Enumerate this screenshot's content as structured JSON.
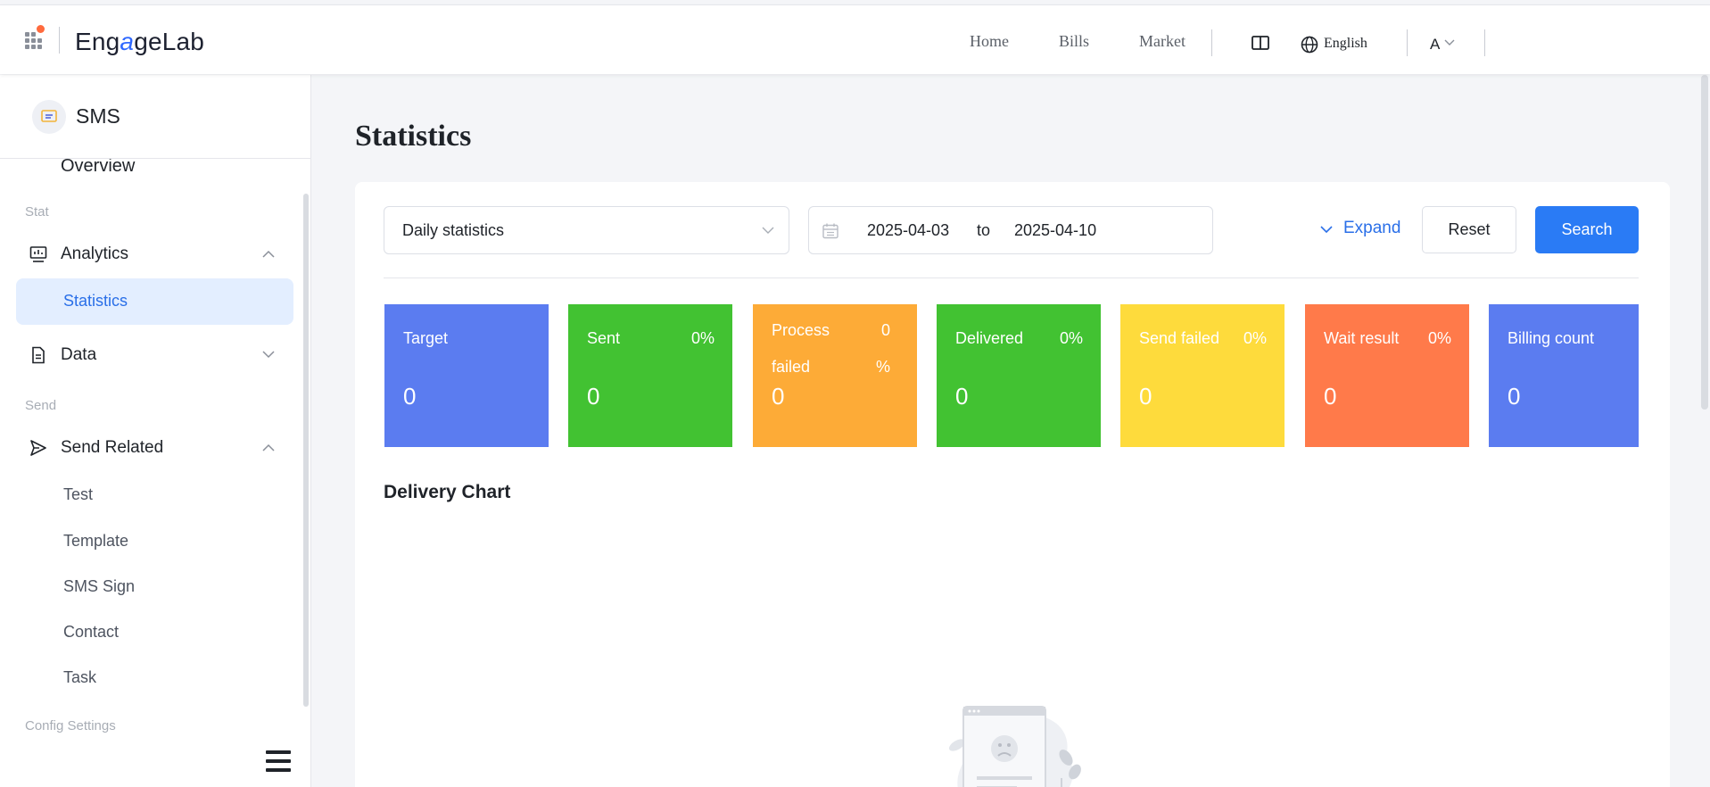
{
  "header": {
    "brand_prefix": "Eng",
    "brand_g": "a",
    "brand_suffix": "geLab",
    "nav": [
      "Home",
      "Bills",
      "Market"
    ],
    "language": "English",
    "user_initial": "A"
  },
  "sidebar": {
    "product": "SMS",
    "cut_item": "Overview",
    "sections": {
      "stat": "Stat",
      "send": "Send",
      "config": "Config Settings"
    },
    "analytics": {
      "label": "Analytics",
      "icon": "chart-icon"
    },
    "statistics": "Statistics",
    "data": {
      "label": "Data",
      "icon": "document-icon"
    },
    "send_related": {
      "label": "Send Related",
      "icon": "send-icon"
    },
    "send_items": [
      "Test",
      "Template",
      "SMS Sign",
      "Contact",
      "Task"
    ]
  },
  "main": {
    "title": "Statistics",
    "filters": {
      "period": "Daily statistics",
      "date_from": "2025-04-03",
      "date_to_label": "to",
      "date_to": "2025-04-10",
      "expand": "Expand",
      "reset": "Reset",
      "search": "Search"
    },
    "stats": [
      {
        "label": "Target",
        "percent": "",
        "value": "0",
        "color": "#5b7cf0"
      },
      {
        "label": "Sent",
        "percent": "0%",
        "value": "0",
        "color": "#42c232"
      },
      {
        "label": "Process failed",
        "percent": "0 %",
        "value": "0",
        "color": "#fdab37"
      },
      {
        "label": "Delivered",
        "percent": "0%",
        "value": "0",
        "color": "#42c232"
      },
      {
        "label": "Send failed",
        "percent": "0%",
        "value": "0",
        "color": "#fedb3c"
      },
      {
        "label": "Wait result",
        "percent": "0%",
        "value": "0",
        "color": "#ff7a4a"
      },
      {
        "label": "Billing count",
        "percent": "",
        "value": "0",
        "color": "#5b7cf0"
      }
    ],
    "chart_title": "Delivery Chart"
  },
  "colors": {
    "accent": "#2a7bf5",
    "active_bg": "#e3eeff",
    "logo_dot": "#ff6a3d"
  }
}
